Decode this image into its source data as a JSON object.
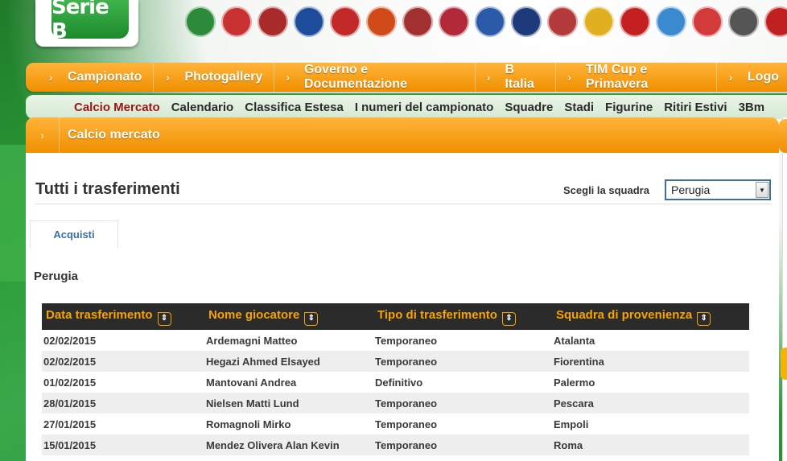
{
  "brand": {
    "logo_text": "Serie B"
  },
  "crests": [
    {
      "name": "avellino-crest",
      "color": "#2d8a3a",
      "label": ""
    },
    {
      "name": "bari-crest",
      "color": "#c83232",
      "label": ""
    },
    {
      "name": "bologna-crest",
      "color": "#a82a2a",
      "label": ""
    },
    {
      "name": "brescia-crest",
      "color": "#1d4c9a",
      "label": ""
    },
    {
      "name": "carpi-crest",
      "color": "#c22a2a",
      "label": ""
    },
    {
      "name": "catania-crest",
      "color": "#d14a1a",
      "label": ""
    },
    {
      "name": "cittadella-crest",
      "color": "#a23030",
      "label": ""
    },
    {
      "name": "crotone-crest",
      "color": "#b22a3a",
      "label": ""
    },
    {
      "name": "entella-crest",
      "color": "#2a5aa8",
      "label": ""
    },
    {
      "name": "frosinone-crest",
      "color": "#1e3a7a",
      "label": ""
    },
    {
      "name": "latina-crest",
      "color": "#b23a3a",
      "label": ""
    },
    {
      "name": "modena-crest",
      "color": "#e0b020",
      "label": ""
    },
    {
      "name": "perugia-crest",
      "color": "#c42020",
      "label": ""
    },
    {
      "name": "pescara-crest",
      "color": "#3a8ad0",
      "label": ""
    },
    {
      "name": "pro-vercelli-crest",
      "color": "#d33a3a",
      "label": ""
    },
    {
      "name": "spezia-crest",
      "color": "#555555",
      "label": ""
    },
    {
      "name": "ternana-crest",
      "color": "#c02020",
      "label": ""
    }
  ],
  "main_nav": [
    "Campionato",
    "Photogallery",
    "Governo e Documentazione",
    "B Italia",
    "TIM Cup e Primavera",
    "Logo"
  ],
  "sub_nav": [
    "Calcio Mercato",
    "Calendario",
    "Classifica Estesa",
    "I numeri del campionato",
    "Squadre",
    "Stadi",
    "Figurine",
    "Ritiri Estivi",
    "3Bm"
  ],
  "section": {
    "title": "Calcio mercato"
  },
  "page": {
    "title": "Tutti i trasferimenti",
    "team_label": "Scegli la squadra",
    "team_selected": "Perugia",
    "tab_label": "Acquisti",
    "team_name": "Perugia"
  },
  "table": {
    "headers": [
      "Data trasferimento",
      "Nome giocatore",
      "Tipo di trasferimento",
      "Squadra di provenienza"
    ],
    "rows": [
      [
        "02/02/2015",
        "Ardemagni Matteo",
        "Temporaneo",
        "Atalanta"
      ],
      [
        "02/02/2015",
        "Hegazi Ahmed Elsayed",
        "Temporaneo",
        "Fiorentina"
      ],
      [
        "01/02/2015",
        "Mantovani Andrea",
        "Definitivo",
        "Palermo"
      ],
      [
        "28/01/2015",
        "Nielsen Matti Lund",
        "Temporaneo",
        "Pescara"
      ],
      [
        "27/01/2015",
        "Romagnoli Mirko",
        "Temporaneo",
        "Empoli"
      ],
      [
        "15/01/2015",
        "Mendez Olivera Alan Kevin",
        "Temporaneo",
        "Roma"
      ]
    ]
  }
}
